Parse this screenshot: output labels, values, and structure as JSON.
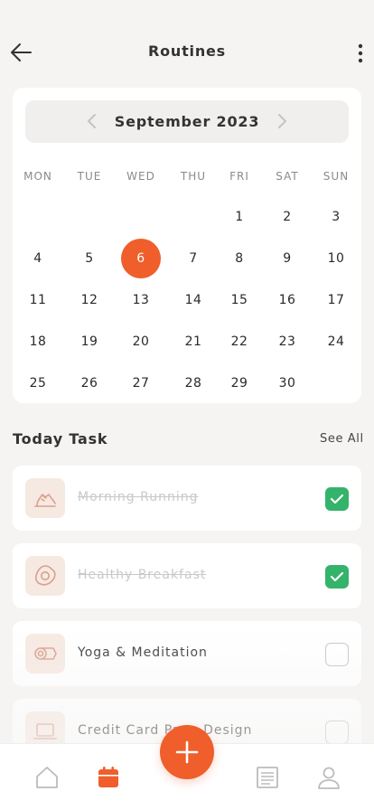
{
  "header": {
    "title": "Routines"
  },
  "calendar": {
    "month_label": "September 2023",
    "weekdays": [
      "MON",
      "TUE",
      "WED",
      "THU",
      "FRI",
      "SAT",
      "SUN"
    ],
    "selected_day": "6",
    "rows": [
      [
        "",
        "",
        "",
        "",
        "1",
        "2",
        "3"
      ],
      [
        "4",
        "5",
        "6",
        "7",
        "8",
        "9",
        "10"
      ],
      [
        "11",
        "12",
        "13",
        "14",
        "15",
        "16",
        "17"
      ],
      [
        "18",
        "19",
        "20",
        "21",
        "22",
        "23",
        "24"
      ],
      [
        "25",
        "26",
        "27",
        "28",
        "29",
        "30",
        ""
      ]
    ]
  },
  "today": {
    "title": "Today Task",
    "see_all": "See All",
    "tasks": [
      {
        "label": "Morning Running",
        "icon": "running-shoe-icon",
        "done": true
      },
      {
        "label": "Healthy Breakfast",
        "icon": "fried-egg-icon",
        "done": true
      },
      {
        "label": "Yoga & Meditation",
        "icon": "yoga-mat-icon",
        "done": false
      },
      {
        "label": "Credit Card Page Design",
        "icon": "laptop-icon",
        "done": false
      }
    ]
  },
  "tabbar": {
    "items": [
      "home-icon",
      "calendar-icon",
      "add-icon",
      "document-icon",
      "profile-icon"
    ],
    "active": "calendar-icon"
  },
  "colors": {
    "accent": "#ef5e2b",
    "check": "#34b36a",
    "icon_bg": "#f6e9e1"
  }
}
